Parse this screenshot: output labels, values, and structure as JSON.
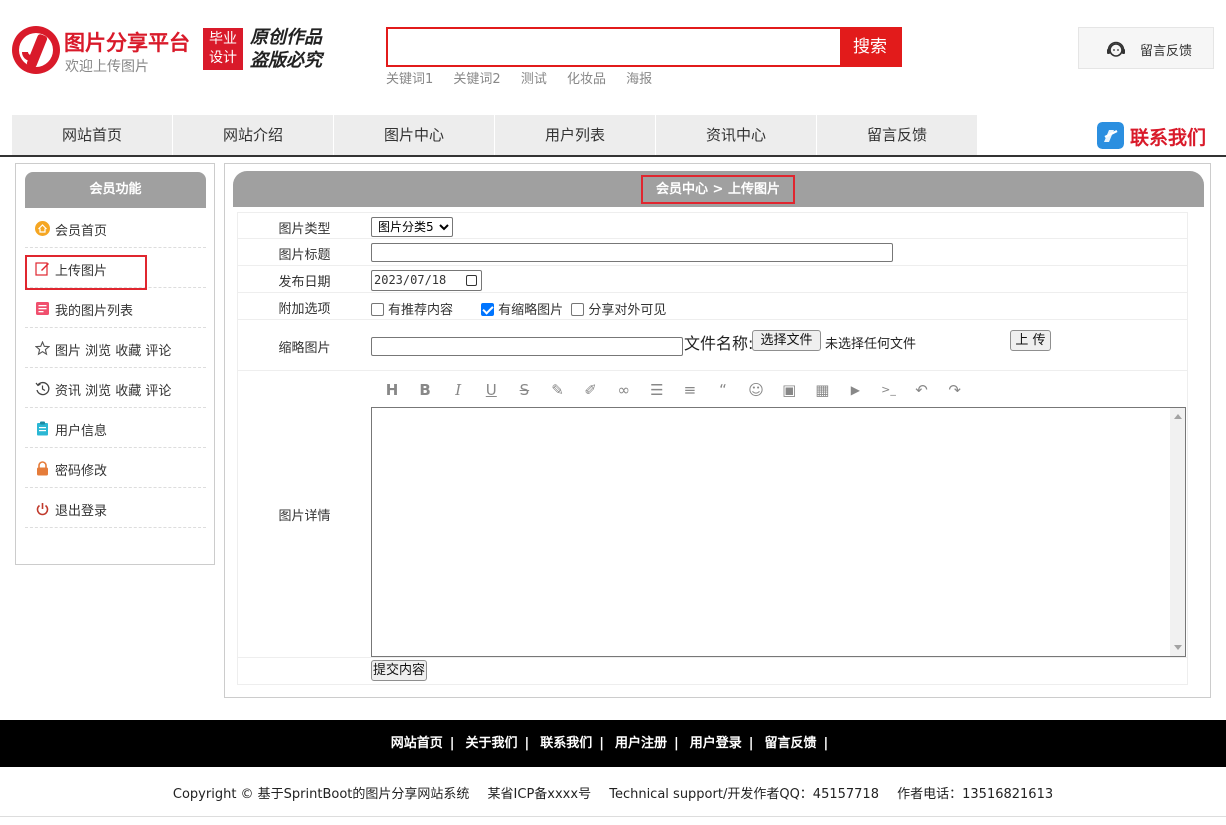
{
  "header": {
    "site_title": "图片分享平台",
    "site_subtitle": "欢迎上传图片",
    "badge_line1": "毕业",
    "badge_line2": "设计",
    "slogan_line1": "原创作品",
    "slogan_line2": "盗版必究",
    "search_value": "",
    "search_button": "搜索",
    "hot_keywords": [
      "关键词1",
      "关键词2",
      "测试",
      "化妆品",
      "海报"
    ],
    "feedback_label": "留言反馈",
    "brand_color": "#d91a2a"
  },
  "nav": {
    "items": [
      "网站首页",
      "网站介绍",
      "图片中心",
      "用户列表",
      "资讯中心",
      "留言反馈"
    ],
    "contact_label": "联系我们"
  },
  "sidebar": {
    "title": "会员功能",
    "items": [
      {
        "label": "会员首页",
        "icon": "home-icon"
      },
      {
        "label": "上传图片",
        "icon": "edit-icon",
        "active": true
      },
      {
        "label": "我的图片列表",
        "icon": "picture-list-icon"
      },
      {
        "label": "图片 浏览 收藏 评论",
        "icon": "star-icon"
      },
      {
        "label": "资讯 浏览 收藏 评论",
        "icon": "history-icon"
      },
      {
        "label": "用户信息",
        "icon": "clipboard-icon"
      },
      {
        "label": "密码修改",
        "icon": "lock-icon"
      },
      {
        "label": "退出登录",
        "icon": "power-icon"
      }
    ]
  },
  "main": {
    "breadcrumb": "会员中心 > 上传图片",
    "form": {
      "type_label": "图片类型",
      "type_value": "图片分类5",
      "title_label": "图片标题",
      "title_value": "",
      "date_label": "发布日期",
      "date_value": "2023/07/18",
      "options_label": "附加选项",
      "options": [
        {
          "label": "有推荐内容",
          "checked": false
        },
        {
          "label": "有缩略图片",
          "checked": true
        },
        {
          "label": "分享对外可见",
          "checked": false
        }
      ],
      "thumb_label": "缩略图片",
      "thumb_value": "",
      "file_name_label": "文件名称:",
      "choose_file_button": "选择文件",
      "no_file_text": "未选择任何文件",
      "upload_button": "上 传",
      "detail_label": "图片详情",
      "toolbar_icons": [
        "heading-icon",
        "bold-icon",
        "italic-icon",
        "underline-icon",
        "strikethrough-icon",
        "pen-icon",
        "brush-icon",
        "link-icon",
        "list-icon",
        "align-icon",
        "quote-icon",
        "emoji-icon",
        "image-icon",
        "table-icon",
        "video-icon",
        "code-icon",
        "undo-icon",
        "redo-icon"
      ],
      "submit_button": "提交内容"
    }
  },
  "footer": {
    "links": [
      "网站首页",
      "关于我们",
      "联系我们",
      "用户注册",
      "用户登录",
      "留言反馈"
    ],
    "separator": "|",
    "copyright": "Copyright © 基于SprintBoot的图片分享网站系统",
    "icp": "某省ICP备xxxx号",
    "support": "Technical support/开发作者QQ：45157718",
    "phone": "作者电话：13516821613"
  }
}
